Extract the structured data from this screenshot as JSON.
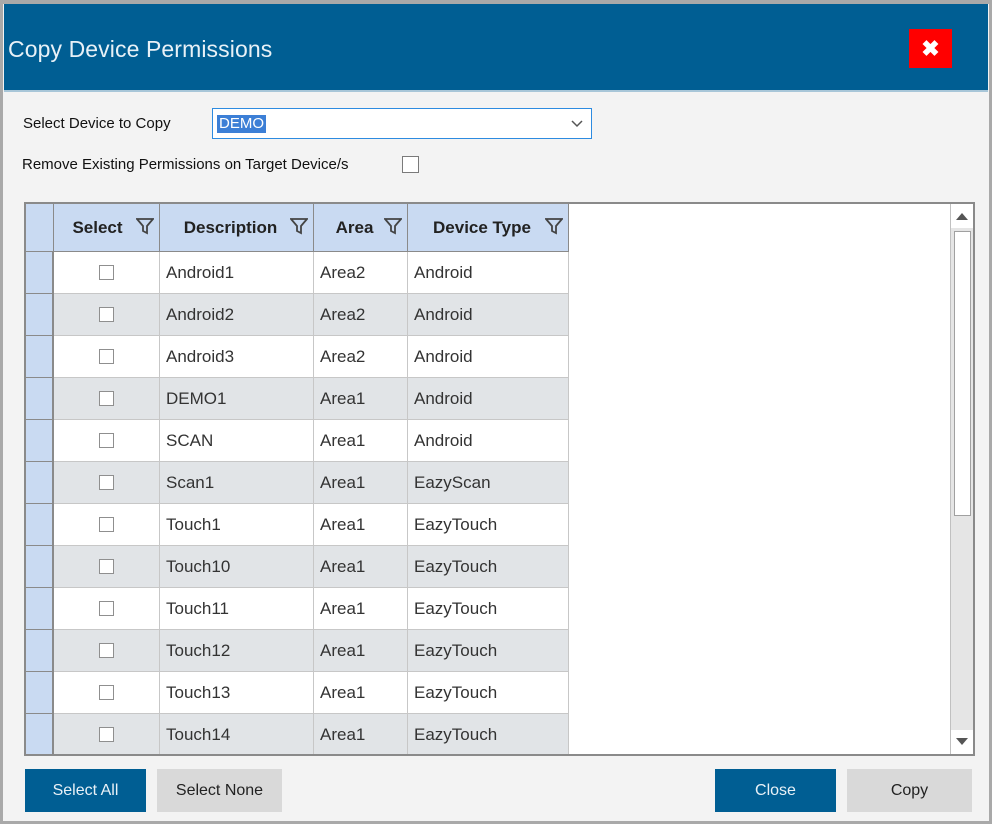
{
  "window": {
    "title": "Copy Device Permissions",
    "close_icon": "close-x-icon"
  },
  "form": {
    "select_device_label": "Select Device to Copy",
    "select_device_value": "DEMO",
    "remove_existing_label": "Remove Existing Permissions on Target Device/s",
    "remove_existing_checked": false
  },
  "grid": {
    "columns": [
      "Select",
      "Description",
      "Area",
      "Device Type"
    ],
    "rows": [
      {
        "selected": false,
        "description": "Android1",
        "area": "Area2",
        "device_type": "Android"
      },
      {
        "selected": false,
        "description": "Android2",
        "area": "Area2",
        "device_type": "Android"
      },
      {
        "selected": false,
        "description": "Android3",
        "area": "Area2",
        "device_type": "Android"
      },
      {
        "selected": false,
        "description": "DEMO1",
        "area": "Area1",
        "device_type": "Android"
      },
      {
        "selected": false,
        "description": "SCAN",
        "area": "Area1",
        "device_type": "Android"
      },
      {
        "selected": false,
        "description": "Scan1",
        "area": "Area1",
        "device_type": "EazyScan"
      },
      {
        "selected": false,
        "description": "Touch1",
        "area": "Area1",
        "device_type": "EazyTouch"
      },
      {
        "selected": false,
        "description": "Touch10",
        "area": "Area1",
        "device_type": "EazyTouch"
      },
      {
        "selected": false,
        "description": "Touch11",
        "area": "Area1",
        "device_type": "EazyTouch"
      },
      {
        "selected": false,
        "description": "Touch12",
        "area": "Area1",
        "device_type": "EazyTouch"
      },
      {
        "selected": false,
        "description": "Touch13",
        "area": "Area1",
        "device_type": "EazyTouch"
      },
      {
        "selected": false,
        "description": "Touch14",
        "area": "Area1",
        "device_type": "EazyTouch"
      }
    ]
  },
  "buttons": {
    "select_all": "Select All",
    "select_none": "Select None",
    "close": "Close",
    "copy": "Copy"
  },
  "colors": {
    "titlebar": "#005e93",
    "close_button": "#ff0000",
    "header_bg": "#c9daf2",
    "primary_button": "#005e93",
    "secondary_button": "#d9d9d9",
    "selection_highlight": "#3c7fd6"
  }
}
